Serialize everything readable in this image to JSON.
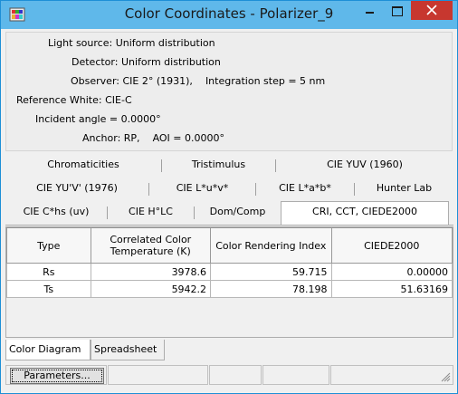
{
  "window": {
    "title": "Color Coordinates - Polarizer_9",
    "icon": "app-palette-icon",
    "colors": {
      "titlebar": "#5fb8ea",
      "close": "#c7372f",
      "accent": "#1d8fd6"
    }
  },
  "info": {
    "light_source": {
      "label": "Light source:",
      "value": "Uniform distribution"
    },
    "detector": {
      "label": "Detector:",
      "value": "Uniform distribution"
    },
    "observer": {
      "label": "Observer:",
      "value": "CIE 2° (1931),",
      "extra": "Integration step = 5 nm"
    },
    "reference_white": {
      "label": "Reference White:",
      "value": "CIE-C"
    },
    "incident_angle": {
      "label": "Incident angle =",
      "value": "0.0000°"
    },
    "anchor": {
      "label": "Anchor:",
      "value": "RP,",
      "extra": "AOI = 0.0000°"
    }
  },
  "tabs": {
    "row1": [
      "Chromaticities",
      "Tristimulus",
      "CIE YUV (1960)"
    ],
    "row2": [
      "CIE YU'V' (1976)",
      "CIE L*u*v*",
      "CIE L*a*b*",
      "Hunter Lab"
    ],
    "row3": [
      "CIE C*hs (uv)",
      "CIE H°LC",
      "Dom/Comp",
      "CRI, CCT, CIEDE2000"
    ],
    "active": "CRI, CCT, CIEDE2000"
  },
  "table": {
    "headers": [
      "Type",
      "Correlated Color Temperature (K)",
      "Color Rendering Index",
      "CIEDE2000"
    ],
    "rows": [
      [
        "Rs",
        "3978.6",
        "59.715",
        "0.00000"
      ],
      [
        "Ts",
        "5942.2",
        "78.198",
        "51.63169"
      ]
    ]
  },
  "bottom_tabs": {
    "items": [
      "Color Diagram",
      "Spreadsheet"
    ],
    "active": "Color Diagram"
  },
  "status": {
    "parameters_button": "Parameters..."
  }
}
